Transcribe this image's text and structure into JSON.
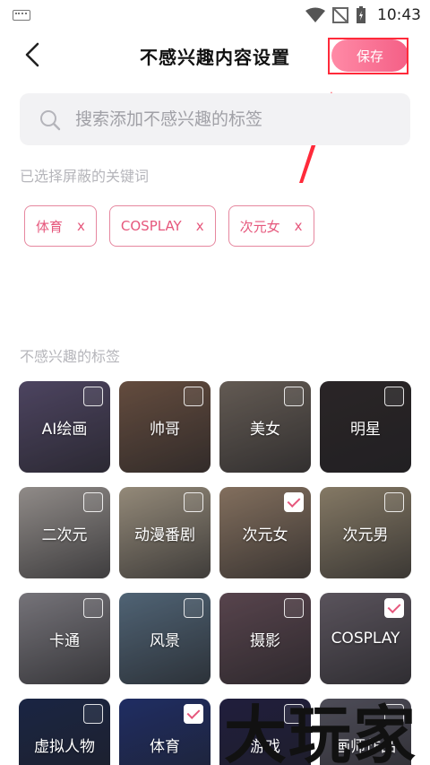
{
  "status_bar": {
    "time": "10:43"
  },
  "header": {
    "title": "不感兴趣内容设置",
    "save_label": "保存"
  },
  "search": {
    "placeholder": "搜索添加不感兴趣的标签"
  },
  "selected_section": {
    "label": "已选择屏蔽的关键词",
    "chips": [
      {
        "text": "体育",
        "remove": "x"
      },
      {
        "text": "COSPLAY",
        "remove": "x"
      },
      {
        "text": "次元女",
        "remove": "x"
      }
    ]
  },
  "tags_section": {
    "label": "不感兴趣的标签",
    "tiles": [
      {
        "label": "AI绘画",
        "checked": false,
        "color": "#6b5f86"
      },
      {
        "label": "帅哥",
        "checked": false,
        "color": "#8b6a57"
      },
      {
        "label": "美女",
        "checked": false,
        "color": "#8a7e74"
      },
      {
        "label": "明星",
        "checked": false,
        "color": "#3b3436"
      },
      {
        "label": "二次元",
        "checked": false,
        "color": "#c8c1bd"
      },
      {
        "label": "动漫番剧",
        "checked": false,
        "color": "#cdbfa8"
      },
      {
        "label": "次元女",
        "checked": true,
        "color": "#b59a82"
      },
      {
        "label": "次元男",
        "checked": false,
        "color": "#b8a88c"
      },
      {
        "label": "卡通",
        "checked": false,
        "color": "#a3a0a8"
      },
      {
        "label": "风景",
        "checked": false,
        "color": "#6f8aa2"
      },
      {
        "label": "摄影",
        "checked": false,
        "color": "#7a5f6b"
      },
      {
        "label": "COSPLAY",
        "checked": true,
        "color": "#7d7480"
      },
      {
        "label": "虚拟人物",
        "checked": false,
        "color": "#25345e"
      },
      {
        "label": "体育",
        "checked": true,
        "color": "#2b3f8a"
      },
      {
        "label": "游戏",
        "checked": false,
        "color": "#2d2a55"
      },
      {
        "label": "画师作品",
        "checked": false,
        "color": "#6c6a7a"
      }
    ]
  },
  "watermark": {
    "text": "大玩家"
  },
  "colors": {
    "accent": "#e6577c",
    "save_gradient_start": "#ff8aa6",
    "save_gradient_end": "#f45f86",
    "annotation_red": "#ff2a3a"
  }
}
